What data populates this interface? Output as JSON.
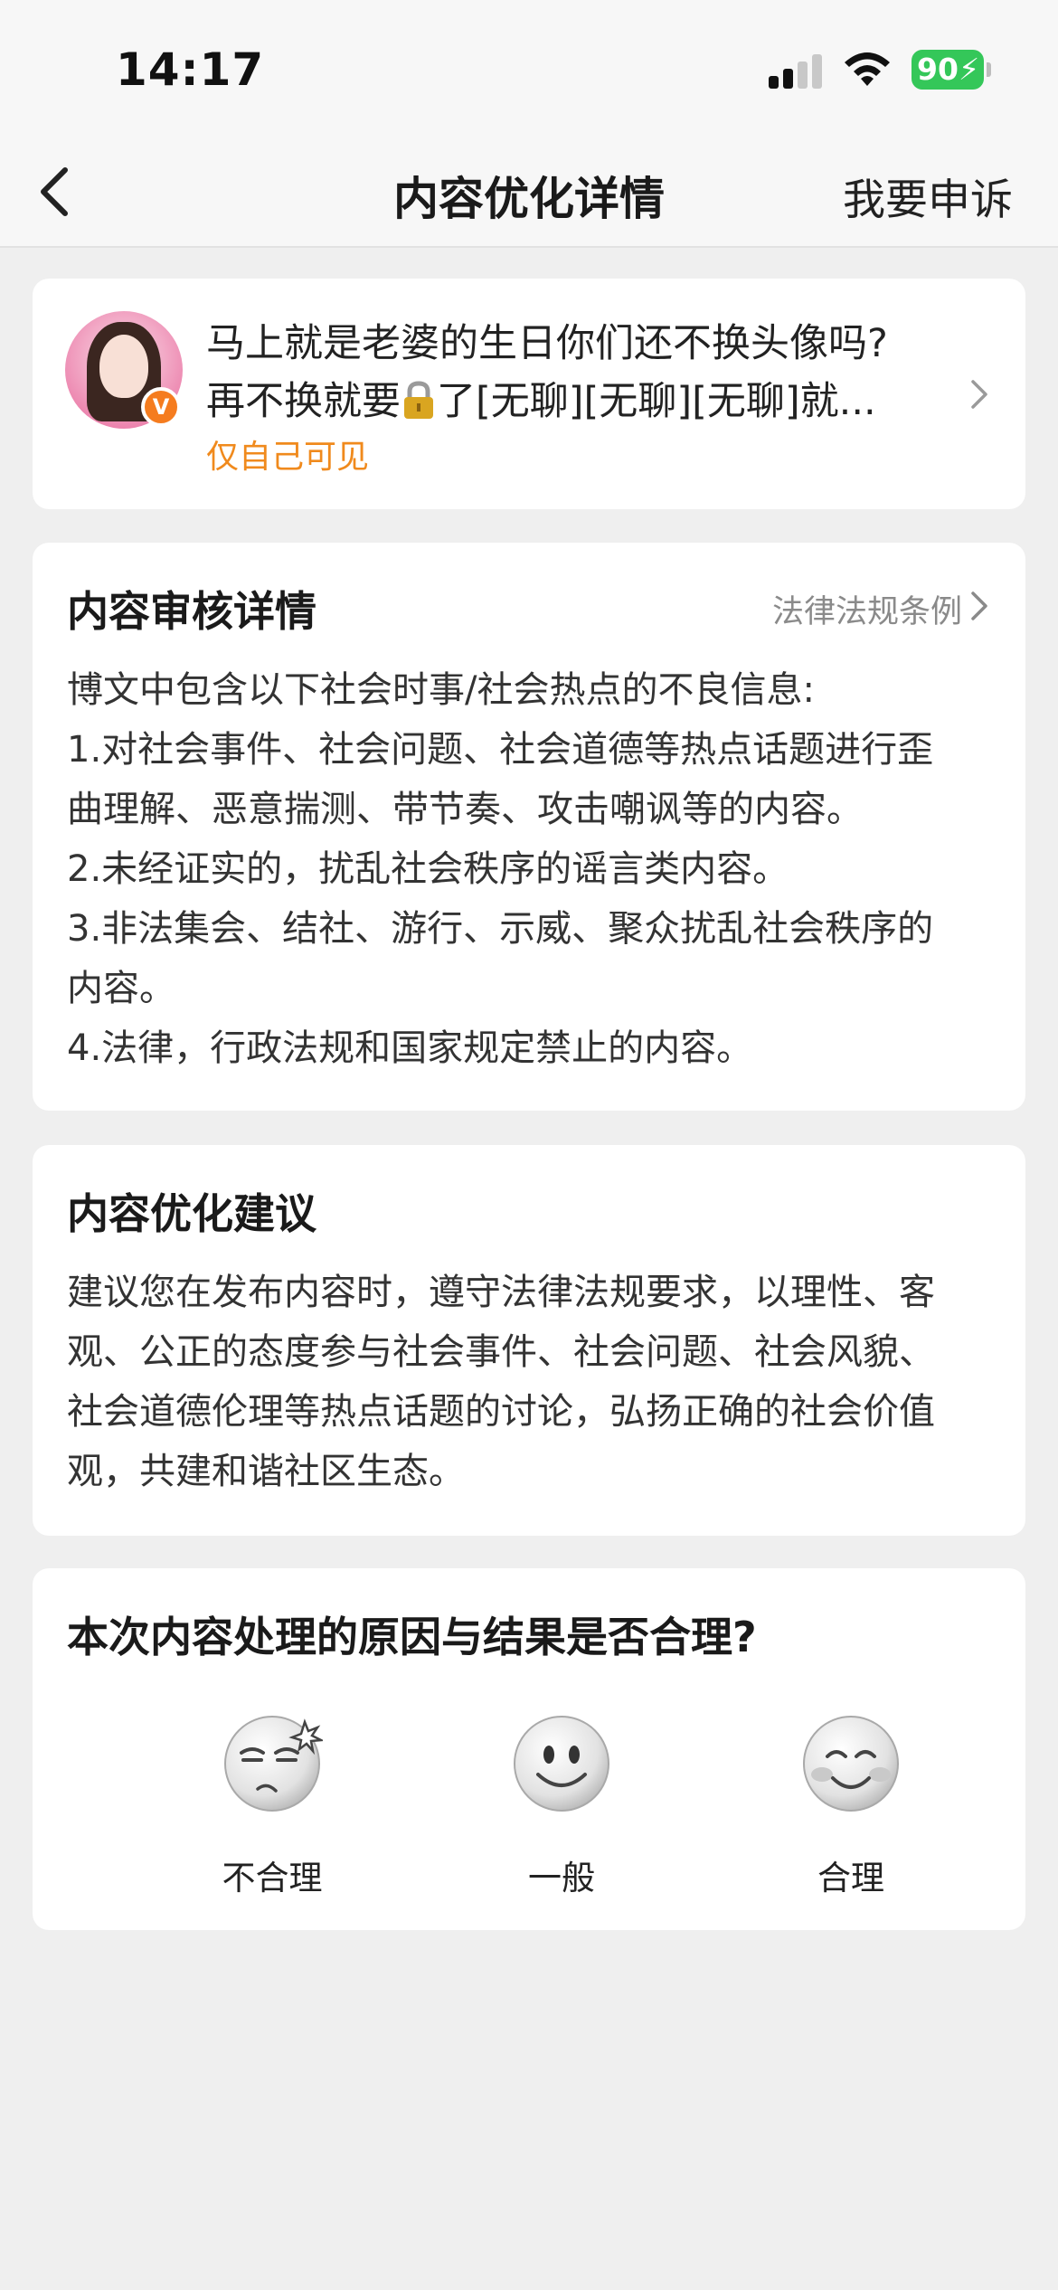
{
  "status_bar": {
    "time": "14:17",
    "battery": "90",
    "icons": [
      "signal-icon",
      "wifi-icon",
      "battery-icon"
    ]
  },
  "nav": {
    "title": "内容优化详情",
    "appeal": "我要申诉",
    "back_icon": "chevron-left-icon"
  },
  "post": {
    "line1": "马上就是老婆的生日你们还不换头像吗?",
    "line2_before": "再不换就要",
    "line2_after": "了[无聊][无聊][无聊]就...",
    "visibility": "仅自己可见",
    "badge": "V",
    "colors": {
      "visibility": "#f08a1d",
      "badge": "#f57c1f"
    }
  },
  "review": {
    "title": "内容审核详情",
    "law_link": "法律法规条例",
    "lines": [
      "博文中包含以下社会时事/社会热点的不良信息:",
      "1.对社会事件、社会问题、社会道德等热点话题进行歪",
      "曲理解、恶意揣测、带节奏、攻击嘲讽等的内容。",
      "2.未经证实的，扰乱社会秩序的谣言类内容。",
      "3.非法集会、结社、游行、示威、聚众扰乱社会秩序的",
      "内容。",
      "4.法律，行政法规和国家规定禁止的内容。"
    ]
  },
  "suggestion": {
    "title": "内容优化建议",
    "lines": [
      "建议您在发布内容时，遵守法律法规要求，以理性、客",
      "观、公正的态度参与社会事件、社会问题、社会风貌、",
      "社会道德伦理等热点话题的讨论，弘扬正确的社会价值",
      "观，共建和谐社区生态。"
    ]
  },
  "feedback": {
    "question": "本次内容处理的原因与结果是否合理?",
    "options": [
      {
        "label": "不合理",
        "icon": "annoyed-face-icon"
      },
      {
        "label": "一般",
        "icon": "smile-face-icon"
      },
      {
        "label": "合理",
        "icon": "happy-face-icon"
      }
    ]
  }
}
